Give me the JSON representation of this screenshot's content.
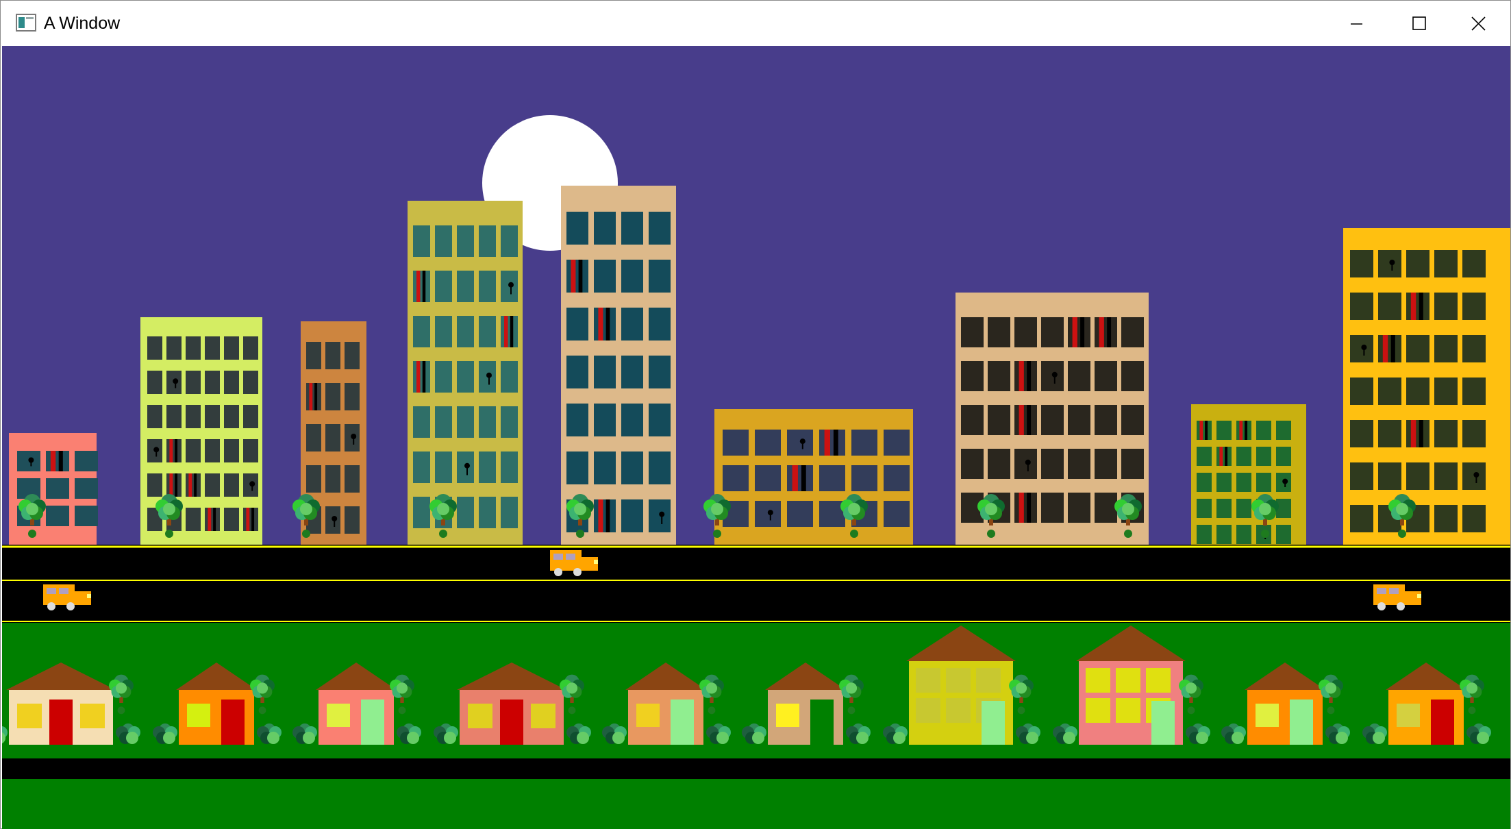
{
  "window": {
    "title": "A Window",
    "icon": "app-window-icon",
    "controls": [
      "minimize-icon",
      "maximize-icon",
      "close-icon"
    ]
  },
  "scene": {
    "colors": {
      "sky": "#483D8B",
      "moon": "#FFFFFF",
      "road": "#000000",
      "road_line": "#FFFF00",
      "grass": "#008000",
      "roof": "#8B4513",
      "trunk": "#8B4513",
      "car": "#FFA500"
    }
  }
}
